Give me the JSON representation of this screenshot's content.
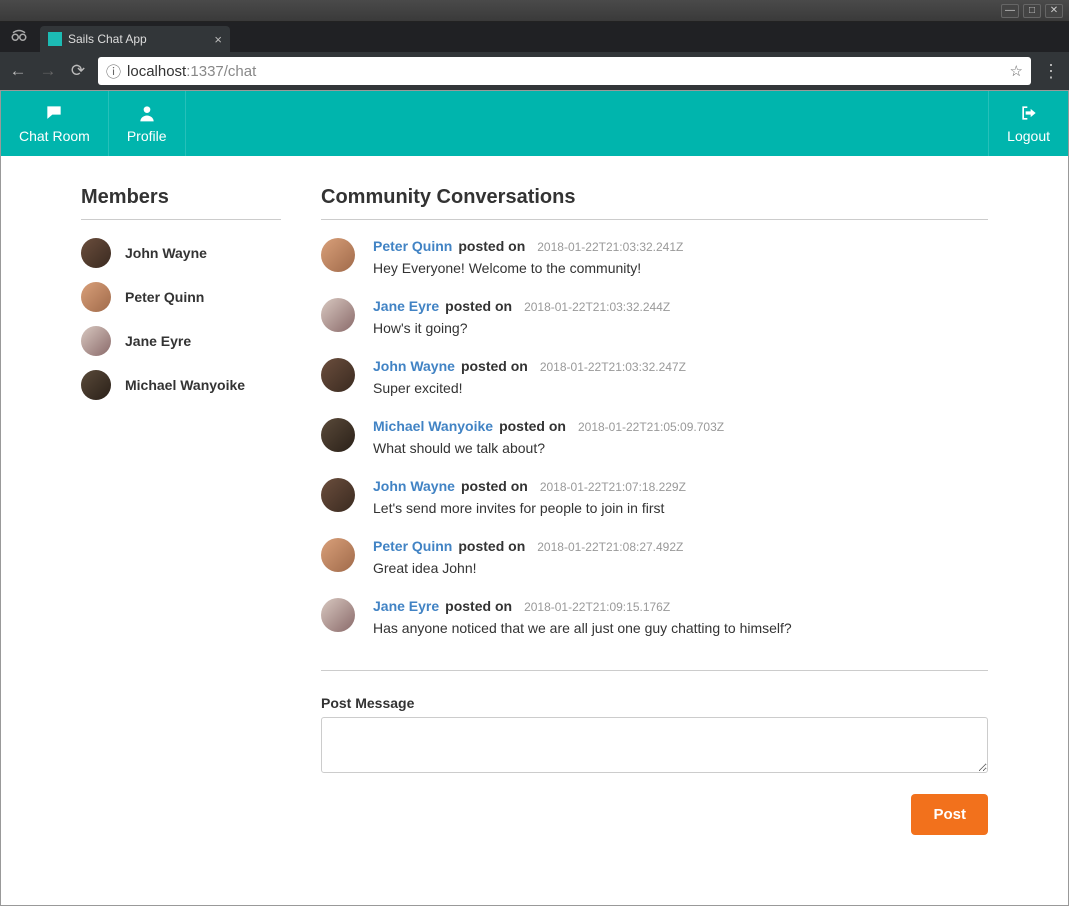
{
  "window": {
    "tab_title": "Sails Chat App",
    "url_host": "localhost",
    "url_port": ":1337",
    "url_path": "/chat"
  },
  "nav": {
    "chat": "Chat Room",
    "profile": "Profile",
    "logout": "Logout"
  },
  "sidebar": {
    "heading": "Members",
    "members": [
      {
        "name": "John Wayne"
      },
      {
        "name": "Peter Quinn"
      },
      {
        "name": "Jane Eyre"
      },
      {
        "name": "Michael Wanyoike"
      }
    ]
  },
  "main": {
    "heading": "Community Conversations",
    "verb": "posted on",
    "posts": [
      {
        "author": "Peter Quinn",
        "time": "2018-01-22T21:03:32.241Z",
        "text": "Hey Everyone! Welcome to the community!"
      },
      {
        "author": "Jane Eyre",
        "time": "2018-01-22T21:03:32.244Z",
        "text": "How's it going?"
      },
      {
        "author": "John Wayne",
        "time": "2018-01-22T21:03:32.247Z",
        "text": "Super excited!"
      },
      {
        "author": "Michael Wanyoike",
        "time": "2018-01-22T21:05:09.703Z",
        "text": "What should we talk about?"
      },
      {
        "author": "John Wayne",
        "time": "2018-01-22T21:07:18.229Z",
        "text": "Let's send more invites for people to join in first"
      },
      {
        "author": "Peter Quinn",
        "time": "2018-01-22T21:08:27.492Z",
        "text": "Great idea John!"
      },
      {
        "author": "Jane Eyre",
        "time": "2018-01-22T21:09:15.176Z",
        "text": "Has anyone noticed that we are all just one guy chatting to himself?"
      }
    ],
    "compose_label": "Post Message",
    "post_button": "Post"
  },
  "avatar_class": {
    "John Wayne": "av-1",
    "Peter Quinn": "av-2",
    "Jane Eyre": "av-3",
    "Michael Wanyoike": "av-4"
  }
}
